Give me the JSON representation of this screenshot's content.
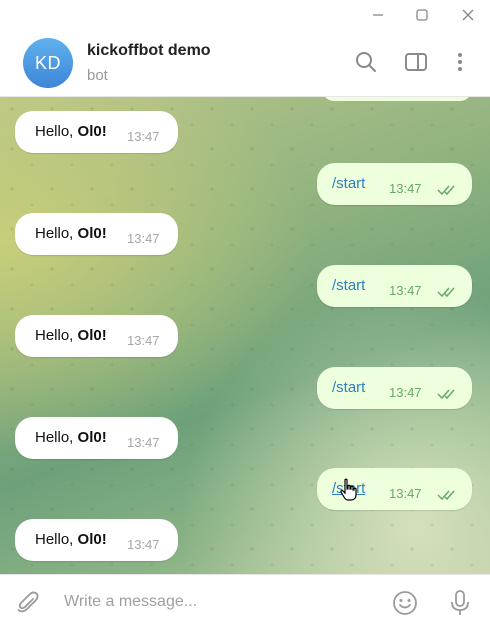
{
  "window": {
    "minimize_icon": "minimize-icon",
    "maximize_icon": "maximize-icon",
    "close_icon": "close-icon"
  },
  "header": {
    "avatar_initials": "KD",
    "title": "kickoffbot demo",
    "subtitle": "bot",
    "avatar_color": "#4a9be3"
  },
  "messages": [
    {
      "direction": "in",
      "greeting": "Hello, ",
      "name": "Ol0!",
      "time": "13:47"
    },
    {
      "direction": "out",
      "text": "/start",
      "time": "13:47"
    },
    {
      "direction": "in",
      "greeting": "Hello, ",
      "name": "Ol0!",
      "time": "13:47"
    },
    {
      "direction": "out",
      "text": "/start",
      "time": "13:47"
    },
    {
      "direction": "in",
      "greeting": "Hello, ",
      "name": "Ol0!",
      "time": "13:47"
    },
    {
      "direction": "out",
      "text": "/start",
      "time": "13:47"
    },
    {
      "direction": "in",
      "greeting": "Hello, ",
      "name": "Ol0!",
      "time": "13:47"
    },
    {
      "direction": "out",
      "text": "/start",
      "time": "13:47"
    },
    {
      "direction": "in",
      "greeting": "Hello, ",
      "name": "Ol0!",
      "time": "13:47"
    }
  ],
  "composer": {
    "placeholder": "Write a message..."
  },
  "colors": {
    "accent": "#3d86d6",
    "outgoing_bubble": "#eeffde",
    "link": "#2f7fc1",
    "read_ticks": "#68a967"
  }
}
